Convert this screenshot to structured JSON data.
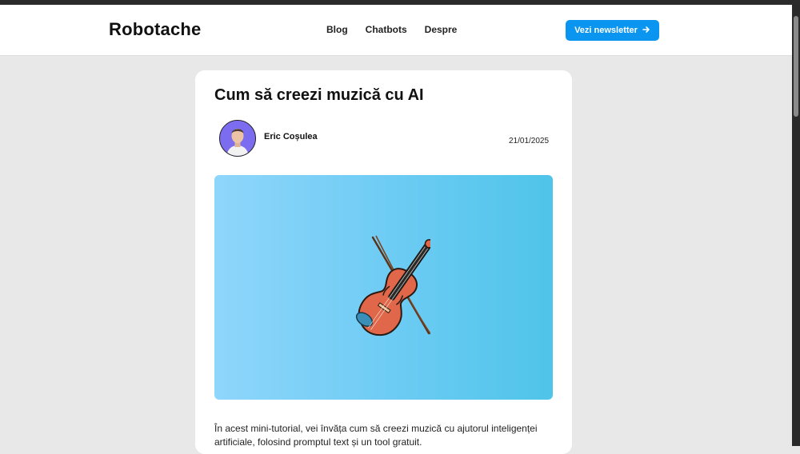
{
  "site": {
    "logo": "Robotache",
    "nav": [
      "Blog",
      "Chatbots",
      "Despre"
    ],
    "newsletter_label": "Vezi newsletter"
  },
  "article": {
    "title": "Cum să creezi muzică cu AI",
    "author": "Eric Coșulea",
    "date": "21/01/2025",
    "intro": "În acest mini-tutorial, vei învăța cum să creezi muzică cu ajutorul inteligenței artificiale, folosind promptul text și un tool gratuit."
  },
  "icons": {
    "newsletter_arrow": "arrow-right-icon",
    "hero": "violin-icon"
  },
  "colors": {
    "accent": "#0a95f0",
    "hero_gradient_start": "#8fd6fb",
    "hero_gradient_end": "#4fc4e9",
    "violin_body": "#e0674a"
  }
}
